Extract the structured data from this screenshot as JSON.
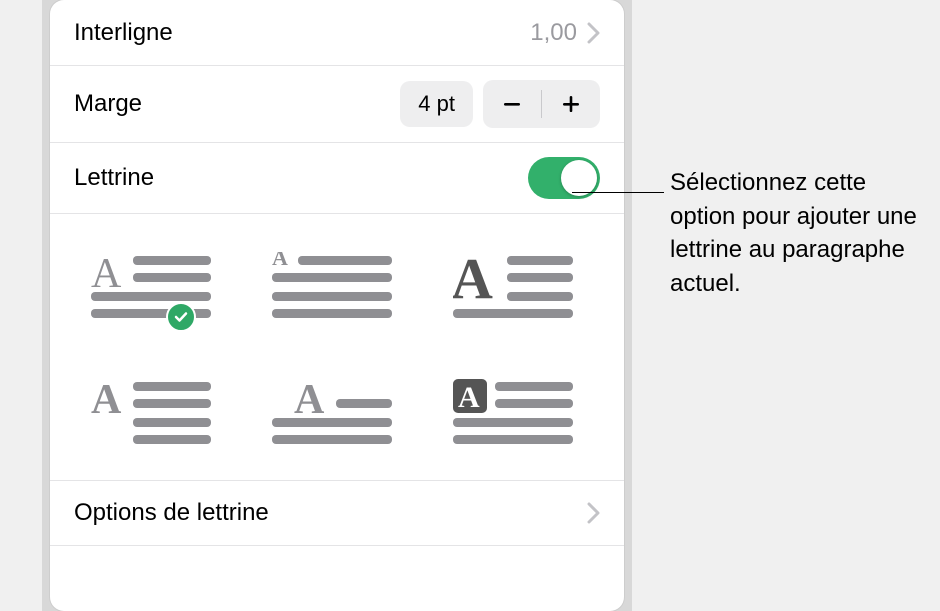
{
  "interligne": {
    "label": "Interligne",
    "value": "1,00"
  },
  "marge": {
    "label": "Marge",
    "value": "4 pt"
  },
  "lettrine": {
    "label": "Lettrine",
    "enabled": true
  },
  "styles": [
    {
      "id": "dropcap-2line-wrap",
      "selected": true
    },
    {
      "id": "dropcap-raised-small",
      "selected": false
    },
    {
      "id": "dropcap-bold-large",
      "selected": false
    },
    {
      "id": "dropcap-full-indent",
      "selected": false
    },
    {
      "id": "dropcap-centered",
      "selected": false
    },
    {
      "id": "dropcap-boxed-inverse",
      "selected": false
    }
  ],
  "options_link": "Options de lettrine",
  "callout": "Sélectionnez cette option pour ajouter une lettrine au paragraphe actuel."
}
